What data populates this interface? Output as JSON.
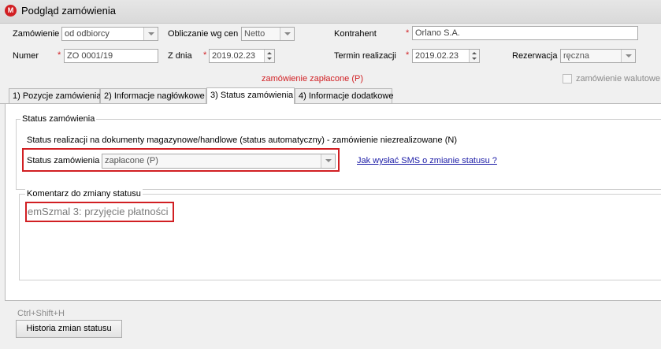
{
  "window": {
    "title": "Podgląd zamówienia",
    "app_icon_letter": "M"
  },
  "header": {
    "order_label": "Zamówienie",
    "order_value": "od odbiorcy",
    "pricing_label": "Obliczanie wg cen",
    "pricing_value": "Netto",
    "contractor_label": "Kontrahent",
    "contractor_value": "Orlano S.A.",
    "number_label": "Numer",
    "number_value": "ZO 0001/19",
    "date_label": "Z dnia",
    "date_value": "2019.02.23",
    "due_label": "Termin realizacji",
    "due_value": "2019.02.23",
    "reservation_label": "Rezerwacja",
    "reservation_value": "ręczna",
    "paid_notice": "zamówienie zapłacone (P)",
    "currency_label": "zamówienie walutowe",
    "required_mark": "*"
  },
  "tabs": [
    {
      "label": "1) Pozycje zamówienia"
    },
    {
      "label": "2) Informacje nagłówkowe"
    },
    {
      "label": "3) Status zamówienia"
    },
    {
      "label": "4) Informacje dodatkowe"
    }
  ],
  "status_group": {
    "legend": "Status zamówienia",
    "auto_status_text": "Status realizacji na dokumenty magazynowe/handlowe (status automatyczny)  -  zamówienie niezrealizowane (N)",
    "status_label": "Status zamówienia",
    "status_value": "zapłacone (P)",
    "sms_link": "Jak wysłać SMS o zmianie statusu ?"
  },
  "comment_group": {
    "legend": "Komentarz do zmiany statusu",
    "comment_value": "emSzmal 3: przyjęcie płatności"
  },
  "footer": {
    "shortcut": "Ctrl+Shift+H",
    "history_button": "Historia zmian statusu"
  },
  "colors": {
    "highlight": "#d11f23",
    "link": "#1a1aa6"
  }
}
